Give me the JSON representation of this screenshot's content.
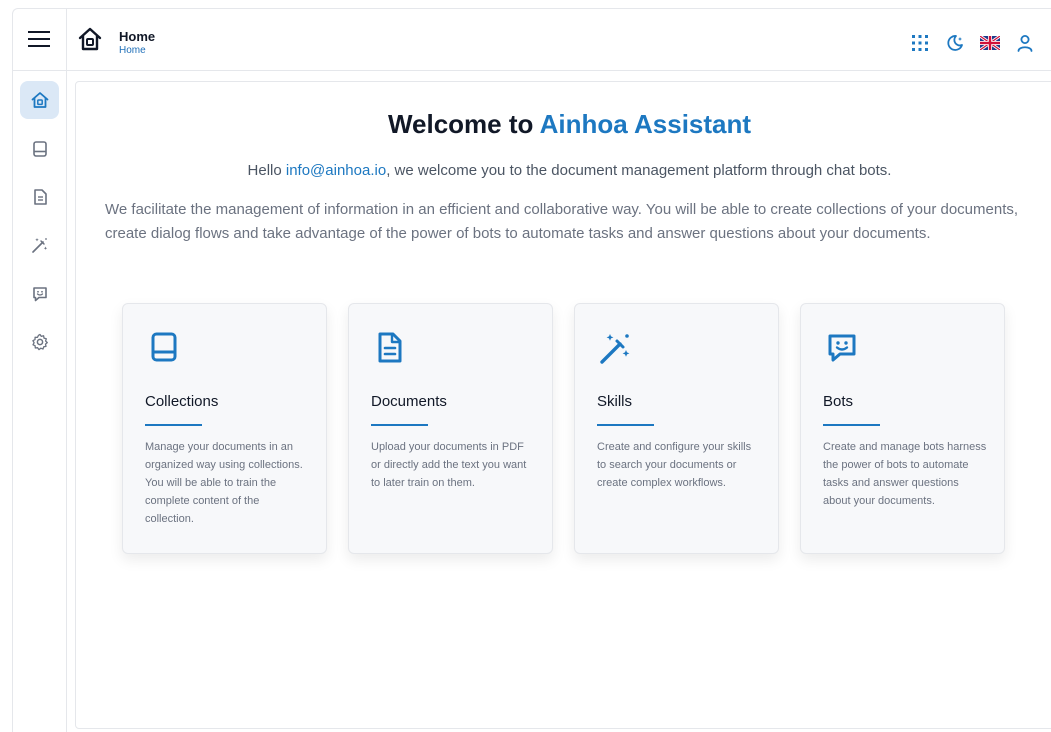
{
  "header": {
    "title": "Home",
    "breadcrumb": "Home"
  },
  "colors": {
    "accent": "#1d78c1",
    "active_nav_bg": "#dbe8f6"
  },
  "top_actions": [
    {
      "icon": "apps-grid-icon"
    },
    {
      "icon": "dark-mode-icon"
    },
    {
      "icon": "language-uk-flag-icon"
    },
    {
      "icon": "user-icon"
    }
  ],
  "sidebar": {
    "items": [
      {
        "name": "home",
        "icon": "home-icon",
        "active": true
      },
      {
        "name": "collections",
        "icon": "book-icon",
        "active": false
      },
      {
        "name": "documents",
        "icon": "document-icon",
        "active": false
      },
      {
        "name": "skills",
        "icon": "magic-wand-icon",
        "active": false
      },
      {
        "name": "bots",
        "icon": "chat-bot-icon",
        "active": false
      },
      {
        "name": "settings",
        "icon": "gear-icon",
        "active": false
      }
    ]
  },
  "main": {
    "welcome_prefix": "Welcome to ",
    "welcome_brand": "Ainhoa Assistant",
    "hello_prefix": "Hello ",
    "hello_email": "info@ainhoa.io",
    "hello_suffix": ", we welcome you to the document management platform through chat bots.",
    "description": "We facilitate the management of information in an efficient and collaborative way. You will be able to create collections of your documents, create dialog flows and take advantage of the power of bots to automate tasks and answer questions about your documents.",
    "cards": [
      {
        "icon": "book-icon",
        "title": "Collections",
        "text": "Manage your documents in an organized way using collections. You will be able to train the complete content of the collection."
      },
      {
        "icon": "document-icon",
        "title": "Documents",
        "text": "Upload your documents in PDF or directly add the text you want to later train on them."
      },
      {
        "icon": "magic-wand-icon",
        "title": "Skills",
        "text": "Create and configure your skills to search your documents or create complex workflows."
      },
      {
        "icon": "chat-bot-icon",
        "title": "Bots",
        "text": "Create and manage bots harness the power of bots to automate tasks and answer questions about your documents."
      }
    ]
  }
}
